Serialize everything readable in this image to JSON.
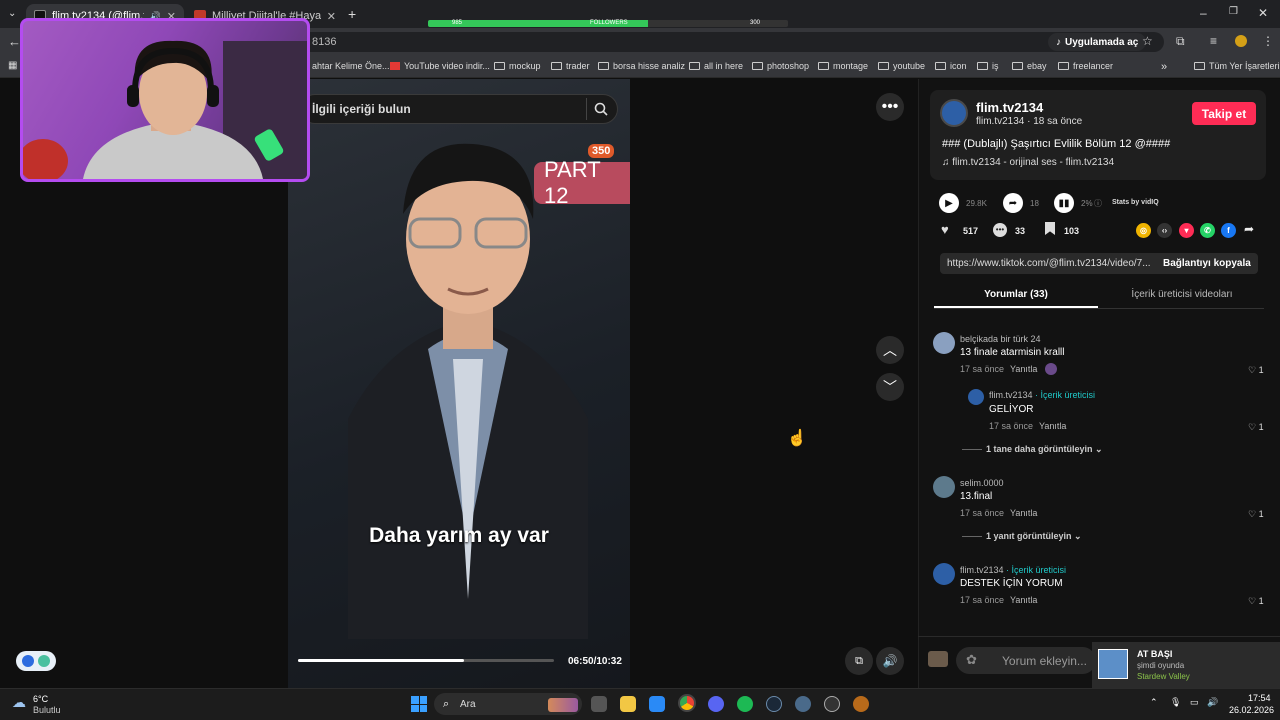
{
  "browser": {
    "tabs": [
      {
        "title": "flim.tv2134 (@flim.tv2134) |",
        "active": true
      },
      {
        "title": "Milliyet Dijital'le #HayatıKaçırma",
        "active": false
      }
    ],
    "new_tab": "+",
    "url": "8136",
    "open_in_app": "Uygulamada aç",
    "bookmarks": [
      "ahtar Kelime Öne...",
      "YouTube video indir...",
      "mockup",
      "trader",
      "borsa hisse analiz",
      "all in here",
      "photoshop",
      "montage",
      "youtube",
      "icon",
      "iş",
      "ebay",
      "freelancer"
    ],
    "all_bookmarks": "Tüm Yer İşaretleri"
  },
  "followers_bar": {
    "left": "985",
    "center": "FOLLOWERS",
    "right": "300",
    "progress": 0.61
  },
  "video": {
    "search_placeholder": "İlgili içeriği bulun",
    "part_label": "PART 12",
    "badge": "350",
    "caption": "Daha yarım ay var",
    "time": "06:50/10:32",
    "progress": 0.65
  },
  "post": {
    "author": "flim.tv2134",
    "author_sub": "flim.tv2134 · 18 sa önce",
    "follow": "Takip et",
    "description": "### (Dublajlı) Şaşırtıcı Evlilik Bölüm 12 @####",
    "sound": "flim.tv2134 - orijinal ses - flim.tv2134",
    "views": "29.8K",
    "shares_stat": "18",
    "engagement": "2%",
    "stats_by": "Stats by vidIQ",
    "likes": "517",
    "comments": "33",
    "saves": "103",
    "link": "https://www.tiktok.com/@flim.tv2134/video/7...",
    "copy_link": "Bağlantıyı kopyala",
    "tab_comments": "Yorumlar (33)",
    "tab_creator": "İçerik üreticisi videoları"
  },
  "comments": [
    {
      "name": "belçikada bir türk 24",
      "text": "13 finale atarmisin kralll",
      "time": "17 sa önce",
      "reply": "Yanıtla",
      "likes": "1"
    },
    {
      "name": "flim.tv2134",
      "creator_tag": "· İçerik üreticisi",
      "text": "GELİYOR",
      "time": "17 sa önce",
      "reply": "Yanıtla",
      "likes": "1"
    },
    {
      "more": "1 tane daha görüntüleyin"
    },
    {
      "name": "selim.0000",
      "text": "13.final",
      "time": "17 sa önce",
      "reply": "Yanıtla",
      "likes": "1"
    },
    {
      "more": "1 yanıt görüntüleyin"
    },
    {
      "name": "flim.tv2134",
      "creator_tag": "· İçerik üreticisi",
      "text": "DESTEK İÇİN YORUM",
      "time": "17 sa önce",
      "reply": "Yanıtla",
      "likes": "1"
    }
  ],
  "comment_input": "Yorum ekleyin...",
  "notification": {
    "title": "AT BAŞI",
    "sub": "şimdi oyunda",
    "game": "Stardew Valley"
  },
  "taskbar": {
    "weather_temp": "6°C",
    "weather_desc": "Bulutlu",
    "search": "Ara",
    "time": "17:54",
    "date": "26.02.2026"
  },
  "colors": {
    "accent": "#fe2c55",
    "creator": "#20c9c9",
    "webcam_border": "#b44cf0"
  }
}
